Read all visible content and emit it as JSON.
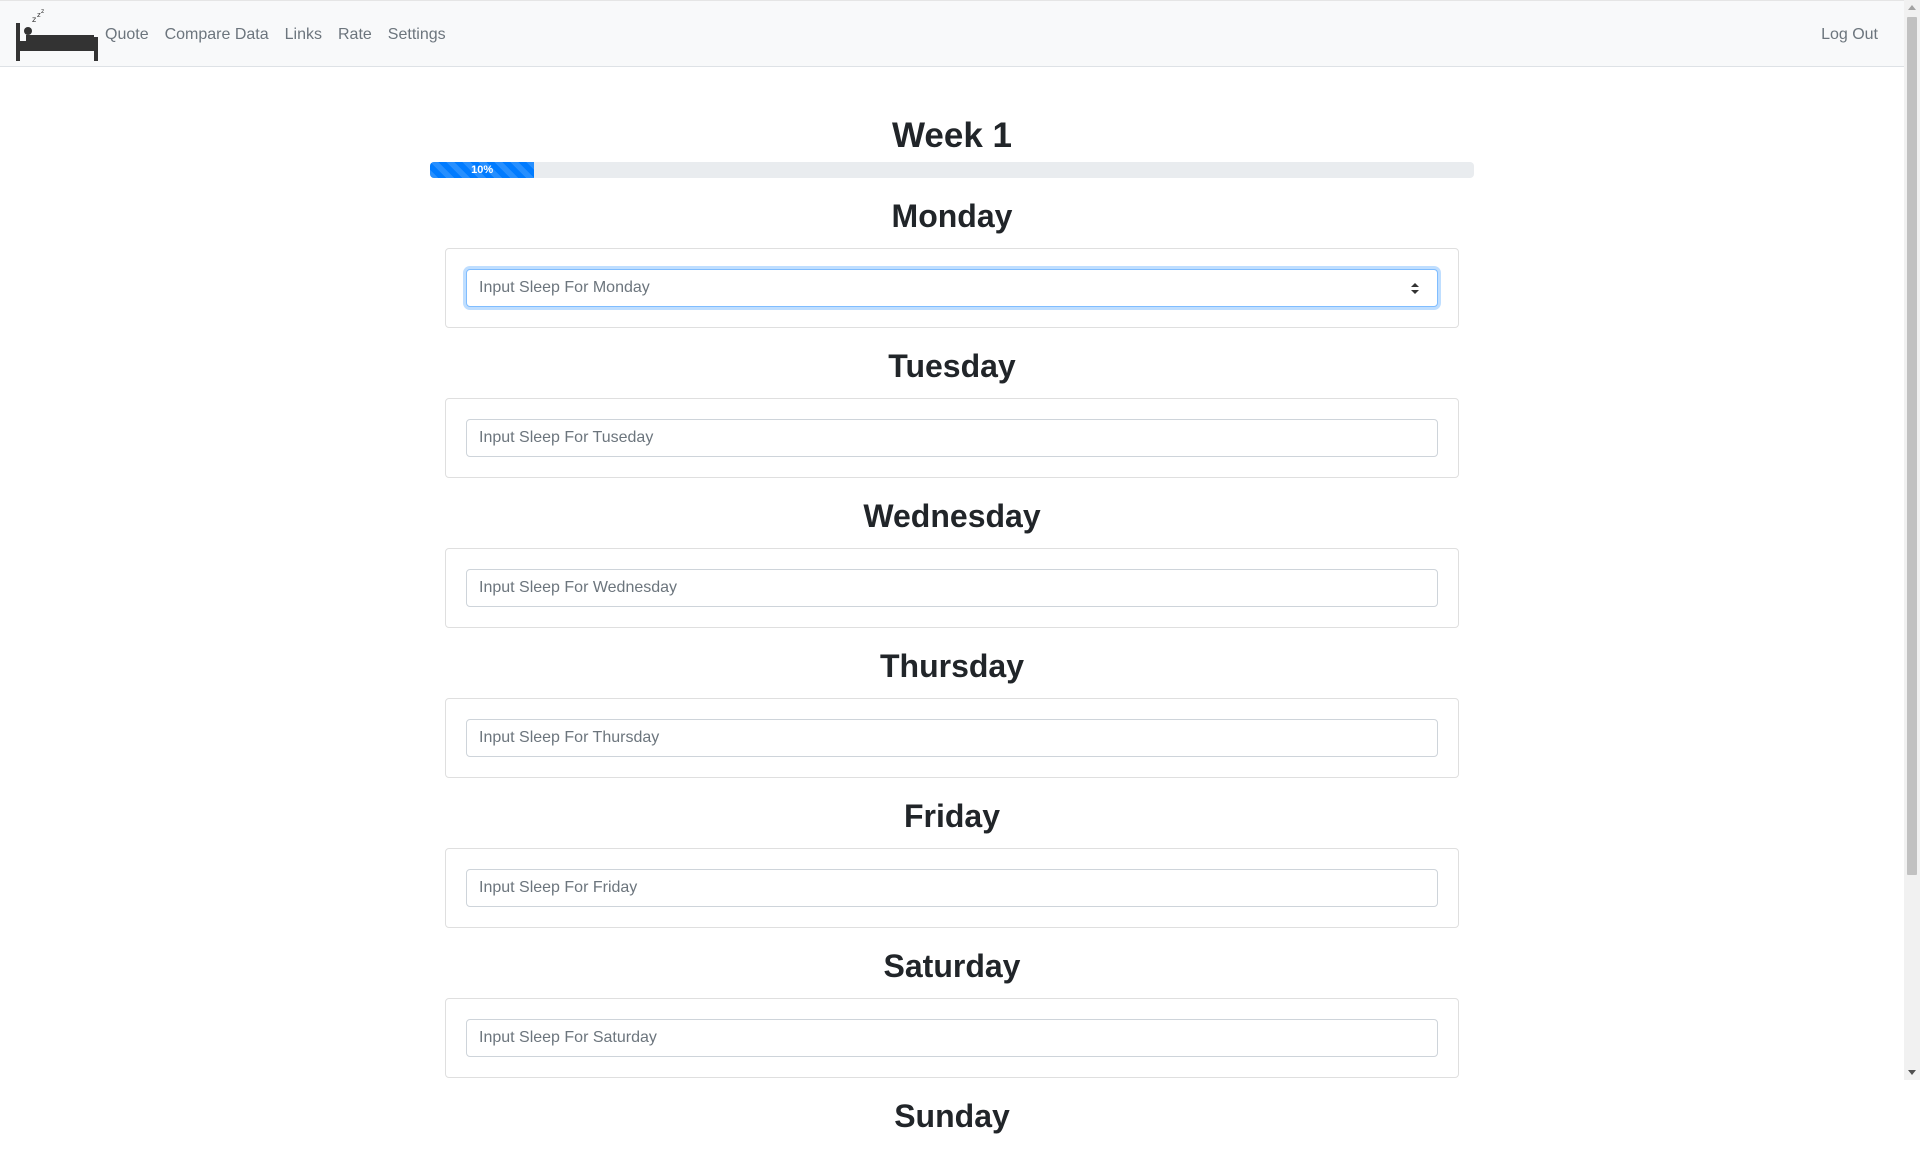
{
  "navbar": {
    "brand_icon": "bed-sleep-icon",
    "links": [
      "Quote",
      "Compare Data",
      "Links",
      "Rate",
      "Settings"
    ],
    "logout": "Log Out"
  },
  "week": {
    "title": "Week 1",
    "progress_percent": 10,
    "progress_label": "10%"
  },
  "days": [
    {
      "name": "Monday",
      "placeholder": "Input Sleep For Monday",
      "value": ""
    },
    {
      "name": "Tuesday",
      "placeholder": "Input Sleep For Tuseday",
      "value": ""
    },
    {
      "name": "Wednesday",
      "placeholder": "Input Sleep For Wednesday",
      "value": ""
    },
    {
      "name": "Thursday",
      "placeholder": "Input Sleep For Thursday",
      "value": ""
    },
    {
      "name": "Friday",
      "placeholder": "Input Sleep For Friday",
      "value": ""
    },
    {
      "name": "Saturday",
      "placeholder": "Input Sleep For Saturday",
      "value": ""
    },
    {
      "name": "Sunday",
      "placeholder": "",
      "value": ""
    }
  ],
  "colors": {
    "accent": "#007bff",
    "navbar_bg": "#f8f9fa",
    "link": "#6c757d"
  }
}
